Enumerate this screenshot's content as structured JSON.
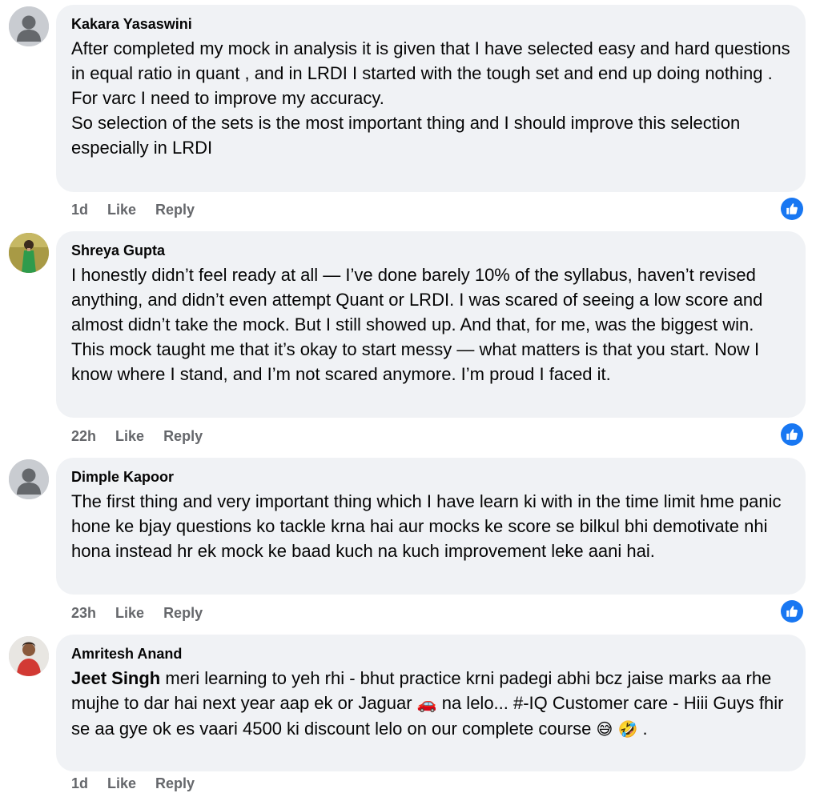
{
  "comments": [
    {
      "author": "Kakara Yasaswini",
      "avatar": "default-avatar",
      "lines": [
        "After completed my mock in analysis it is given that I have selected easy and hard questions in equal ratio in quant , and in LRDI I started with the tough set and end up doing nothing .",
        "For varc I need to improve my accuracy.",
        "So selection of the sets is the most important thing and I should improve this selection especially in LRDI"
      ],
      "time": "1d",
      "like": "Like",
      "reply": "Reply",
      "reaction": "like-icon"
    },
    {
      "author": "Shreya Gupta",
      "avatar": "photo-avatar-green-dress",
      "lines": [
        "I honestly didn’t feel ready at all — I’ve done barely 10% of the syllabus, haven’t revised anything, and didn’t even attempt Quant or LRDI. I was scared of seeing a low score and almost didn’t take the mock. But I still showed up. And that, for me, was the biggest win.",
        "This mock taught me that it’s okay to start messy — what matters is that you start. Now I know where I stand, and I’m not scared anymore. I’m proud I faced it."
      ],
      "time": "22h",
      "like": "Like",
      "reply": "Reply",
      "reaction": "like-icon"
    },
    {
      "author": "Dimple Kapoor",
      "avatar": "default-avatar",
      "lines": [
        "The first thing and very important thing which I have learn ki with in the time limit hme panic hone ke bjay questions ko tackle krna hai aur mocks ke score se bilkul bhi demotivate nhi hona instead hr ek mock ke baad kuch na kuch improvement leke aani hai."
      ],
      "time": "23h",
      "like": "Like",
      "reply": "Reply",
      "reaction": "like-icon"
    },
    {
      "author": "Amritesh Anand",
      "avatar": "photo-avatar-man",
      "mention": "Jeet Singh",
      "text_part1": " meri learning to yeh rhi - bhut practice krni padegi abhi bcz jaise marks aa rhe mujhe to dar hai next year aap ek or Jaguar ",
      "emoji_car": "🚗",
      "text_part2": " na lelo... #-IQ Customer care - Hiii Guys fhir se aa gye ok es vaari 4500 ki discount lelo on our complete course ",
      "emoji_grin": "😅",
      "emoji_laugh": "🤣",
      "text_part3": " .",
      "time": "1d",
      "like": "Like",
      "reply": "Reply"
    }
  ],
  "colors": {
    "bubble": "#f0f2f5",
    "text": "#050505",
    "meta": "#65676b",
    "like_blue": "#1877f2"
  }
}
